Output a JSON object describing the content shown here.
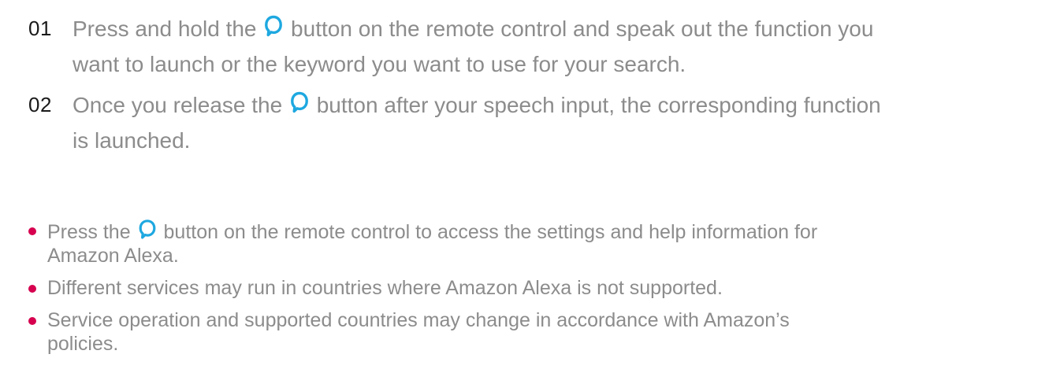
{
  "steps": [
    {
      "number": "01",
      "text_before": "Press and hold the",
      "text_after": "button on the remote control and speak out the function you",
      "text_line2": "want to launch or the keyword you want to use for your search."
    },
    {
      "number": "02",
      "text_before": "Once you release the",
      "text_after": "button after your speech input, the corresponding function",
      "text_line2": "is launched."
    }
  ],
  "notes": [
    {
      "text_before": "Press the",
      "text_after": "button on the remote control to access the settings and help information for",
      "text_line2": "Amazon Alexa."
    },
    {
      "text": "Different services may run in countries where Amazon Alexa is not supported."
    },
    {
      "text": "Service operation and supported countries may change in accordance with Amazon’s",
      "text_line2": "policies."
    }
  ],
  "colors": {
    "body_text": "#8c8c8c",
    "step_number": "#1a1a1a",
    "bullet": "#d6004f",
    "alexa_icon": "#1ea8e0"
  },
  "icons": {
    "alexa_button": "alexa-ring-icon"
  }
}
